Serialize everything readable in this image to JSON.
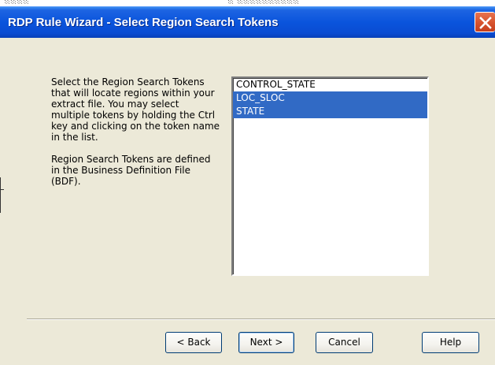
{
  "window": {
    "title": "RDP Rule Wizard - Select Region Search Tokens",
    "title_color": "#ffffff",
    "accent": "#0a54dc",
    "close_icon": "close-icon"
  },
  "description": {
    "paragraph1": "Select the Region Search Tokens that will locate regions within your extract file.  You may select multiple tokens by holding the Ctrl key and clicking on the token name in the list.",
    "paragraph2": "Region Search Tokens are defined in the Business Definition File (BDF)."
  },
  "tokens": {
    "items": [
      {
        "label": "CONTROL_STATE",
        "selected": false
      },
      {
        "label": "LOC_SLOC",
        "selected": true
      },
      {
        "label": "STATE",
        "selected": true
      }
    ],
    "selection_color": "#316ac5"
  },
  "buttons": {
    "back": "< Back",
    "next": "Next >",
    "cancel": "Cancel",
    "help": "Help"
  }
}
